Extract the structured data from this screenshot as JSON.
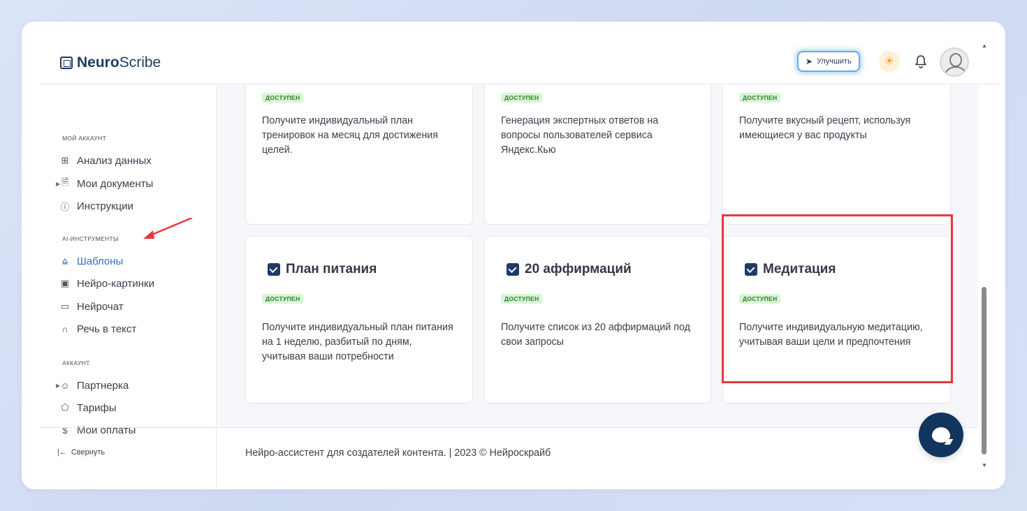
{
  "header": {
    "logo_bold": "Neuro",
    "logo_light": "Scribe",
    "upgrade_label": "Улучшить"
  },
  "sidebar": {
    "sections": [
      {
        "title": "МОЙ АККАУНТ",
        "items": [
          {
            "label": "Анализ данных",
            "icon": "grid-icon"
          },
          {
            "label": "Мои документы",
            "icon": "document-icon",
            "expandable": true
          },
          {
            "label": "Инструкции",
            "icon": "help-circle-icon"
          }
        ]
      },
      {
        "title": "AI-ИНСТРУМЕНТЫ",
        "items": [
          {
            "label": "Шаблоны",
            "icon": "layers-icon",
            "active": true
          },
          {
            "label": "Нейро-картинки",
            "icon": "image-icon"
          },
          {
            "label": "Нейрочат",
            "icon": "chat-icon"
          },
          {
            "label": "Речь в текст",
            "icon": "headphones-icon"
          }
        ]
      },
      {
        "title": "АККАУНТ",
        "items": [
          {
            "label": "Партнерка",
            "icon": "users-icon",
            "expandable": true
          },
          {
            "label": "Тарифы",
            "icon": "tag-icon"
          },
          {
            "label": "Мои оплаты",
            "icon": "dollar-icon"
          }
        ]
      }
    ],
    "collapse_label": "Свернуть"
  },
  "cards": [
    {
      "badge": "ДОСТУПЕН",
      "desc": "Получите индивидуальный план тренировок на месяц для достижения целей."
    },
    {
      "badge": "ДОСТУПЕН",
      "desc": "Генерация экспертных ответов на вопросы пользователей сервиса Яндекс.Кью"
    },
    {
      "badge": "ДОСТУПЕН",
      "desc": "Получите вкусный рецепт, используя имеющиеся у вас продукты"
    },
    {
      "title": "План питания",
      "badge": "ДОСТУПЕН",
      "desc": "Получите индивидуальный план питания на 1 неделю, разбитый по дням, учитывая ваши потребности"
    },
    {
      "title": "20 аффирмаций",
      "badge": "ДОСТУПЕН",
      "desc": "Получите список из 20 аффирмаций под свои запросы"
    },
    {
      "title": "Медитация",
      "badge": "ДОСТУПЕН",
      "desc": "Получите индивидуальную медитацию, учитывая ваши цели и предпочтения"
    }
  ],
  "footer": {
    "text": "Нейро-ассистент для создателей контента.  | 2023 © Нейроскрайб"
  },
  "colors": {
    "accent": "#2f6fbf",
    "brand_dark": "#12355e",
    "badge_bg": "#d7f5d5",
    "badge_text": "#2d7a2d",
    "highlight": "#e8383d"
  }
}
